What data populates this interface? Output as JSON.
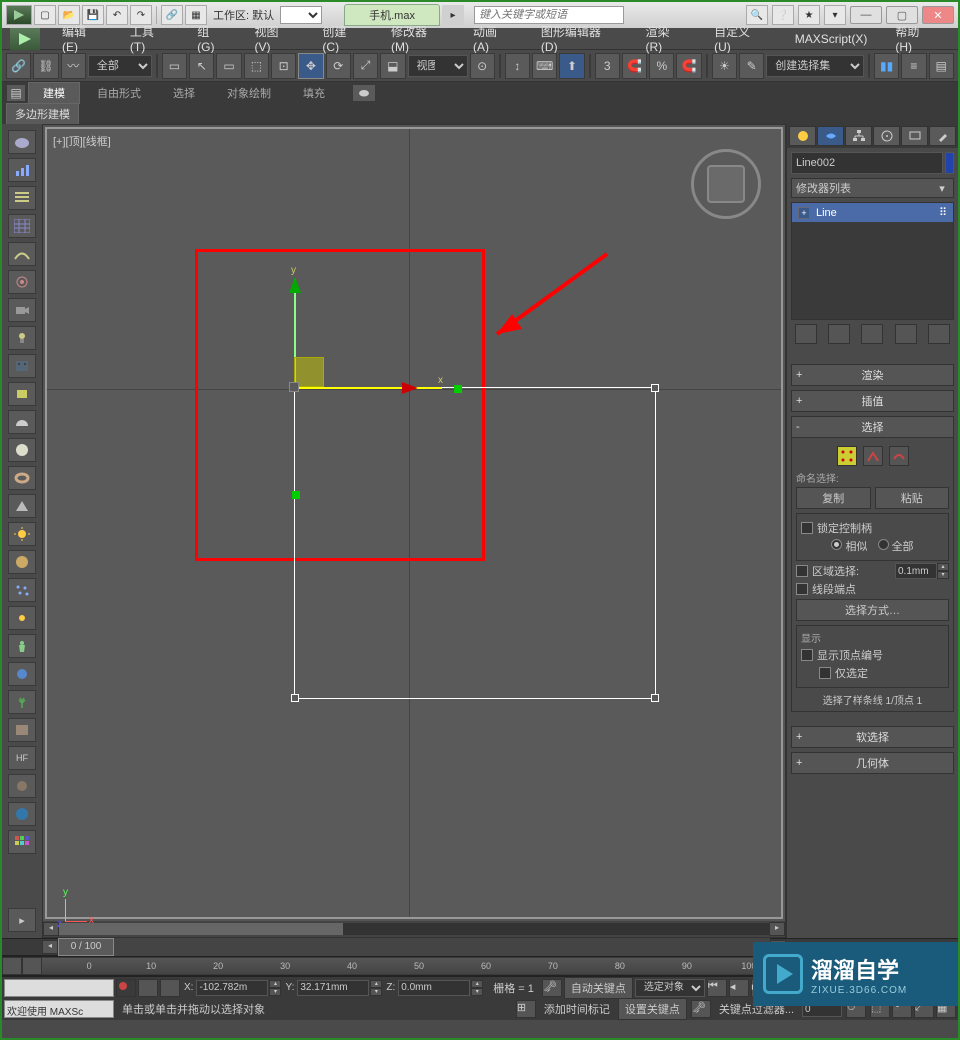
{
  "titlebar": {
    "workspace_label": "工作区: 默认",
    "filename": "手机.max",
    "search_placeholder": "键入关键字或短语"
  },
  "menu": {
    "items": [
      "编辑(E)",
      "工具(T)",
      "组(G)",
      "视图(V)",
      "创建(C)",
      "修改器(M)",
      "动画(A)",
      "图形编辑器(D)",
      "渲染(R)",
      "自定义(U)",
      "MAXScript(X)",
      "帮助(H)"
    ]
  },
  "toolbar": {
    "filter_all": "全部",
    "view_label": "视图",
    "create_set": "创建选择集"
  },
  "tabs": {
    "items": [
      "建模",
      "自由形式",
      "选择",
      "对象绘制",
      "填充"
    ],
    "active": 0,
    "subtab": "多边形建模"
  },
  "viewport": {
    "label": "[+][顶][线框]",
    "axis_x": "x",
    "axis_y": "y",
    "axis_z": "z"
  },
  "right_panel": {
    "object_name": "Line002",
    "modifier_list_label": "修改器列表",
    "stack_item": "Line",
    "sections": {
      "render": "渲染",
      "interp": "插值",
      "selection": "选择",
      "soft_sel": "软选择",
      "geometry": "几何体"
    },
    "named_sel": "命名选择:",
    "copy": "复制",
    "paste": "粘贴",
    "lock_handles": "锁定控制柄",
    "similar": "相似",
    "all": "全部",
    "area_select": "区域选择:",
    "area_value": "0.1mm",
    "segment_end": "线段端点",
    "select_by": "选择方式…",
    "display": "显示",
    "show_vertex_num": "显示顶点编号",
    "only_selected": "仅选定",
    "selection_info": "选择了样条线 1/顶点 1"
  },
  "timeline": {
    "slider": "0 / 100",
    "ticks": [
      "0",
      "10",
      "20",
      "30",
      "40",
      "50",
      "60",
      "70",
      "80",
      "90",
      "100"
    ]
  },
  "coords": {
    "x_label": "X:",
    "x_val": "-102.782m",
    "y_label": "Y:",
    "y_val": "32.171mm",
    "z_label": "Z:",
    "z_val": "0.0mm",
    "grid": "栅格 = 1"
  },
  "status": {
    "auto_key": "自动关键点",
    "set_key": "设置关键点",
    "selected_obj": "选定对象",
    "key_filter": "关键点过滤器..."
  },
  "status2": {
    "welcome": "欢迎使用 MAXSc",
    "hint": "单击或单击并拖动以选择对象",
    "add_marker": "添加时间标记"
  },
  "watermark": {
    "main": "溜溜自学",
    "sub": "ZIXUE.3D66.COM"
  }
}
